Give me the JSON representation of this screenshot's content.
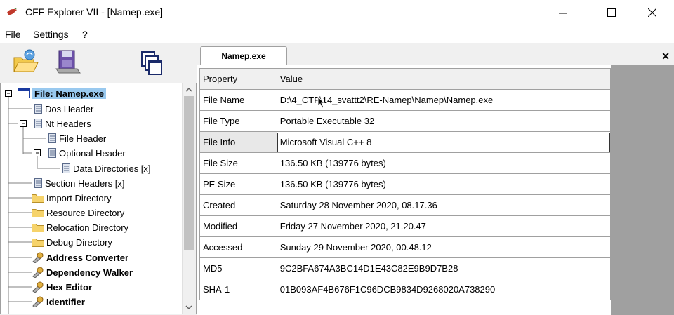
{
  "window": {
    "title": "CFF Explorer VII - [Namep.exe]"
  },
  "menu": {
    "items": [
      "File",
      "Settings",
      "?"
    ]
  },
  "tab": {
    "label": "Namep.exe"
  },
  "tree": {
    "items": [
      {
        "label": "File: Namep.exe",
        "icon": "window-icon"
      },
      {
        "label": "Dos Header",
        "icon": "document-icon"
      },
      {
        "label": "Nt Headers",
        "icon": "document-icon"
      },
      {
        "label": "File Header",
        "icon": "document-icon"
      },
      {
        "label": "Optional Header",
        "icon": "document-icon"
      },
      {
        "label": "Data Directories [x]",
        "icon": "document-icon"
      },
      {
        "label": "Section Headers [x]",
        "icon": "document-icon"
      },
      {
        "label": "Import Directory",
        "icon": "folder-icon"
      },
      {
        "label": "Resource Directory",
        "icon": "folder-icon"
      },
      {
        "label": "Relocation Directory",
        "icon": "folder-icon"
      },
      {
        "label": "Debug Directory",
        "icon": "folder-icon"
      },
      {
        "label": "Address Converter",
        "icon": "tool-icon"
      },
      {
        "label": "Dependency Walker",
        "icon": "tool-icon"
      },
      {
        "label": "Hex Editor",
        "icon": "tool-icon"
      },
      {
        "label": "Identifier",
        "icon": "tool-icon"
      }
    ]
  },
  "grid": {
    "header": {
      "property": "Property",
      "value": "Value"
    },
    "rows": [
      {
        "property": "File Name",
        "value": "D:\\4_CTF\\14_svattt2\\RE-Namep\\Namep\\Namep.exe"
      },
      {
        "property": "File Type",
        "value": "Portable Executable 32"
      },
      {
        "property": "File Info",
        "value": "Microsoft Visual C++ 8"
      },
      {
        "property": "File Size",
        "value": "136.50 KB (139776 bytes)"
      },
      {
        "property": "PE Size",
        "value": "136.50 KB (139776 bytes)"
      },
      {
        "property": "Created",
        "value": "Saturday 28 November 2020, 08.17.36"
      },
      {
        "property": "Modified",
        "value": "Friday 27 November 2020, 21.20.47"
      },
      {
        "property": "Accessed",
        "value": "Sunday 29 November 2020, 00.48.12"
      },
      {
        "property": "MD5",
        "value": "9C2BFA674A3BC14D1E43C82E9B9D7B28"
      },
      {
        "property": "SHA-1",
        "value": "01B093AF4B676F1C96DCB9834D9268020A738290"
      }
    ]
  },
  "colors": {
    "selection": "#99c9ef",
    "grid_border": "#a0a0a0",
    "gray_area": "#a0a0a0"
  }
}
